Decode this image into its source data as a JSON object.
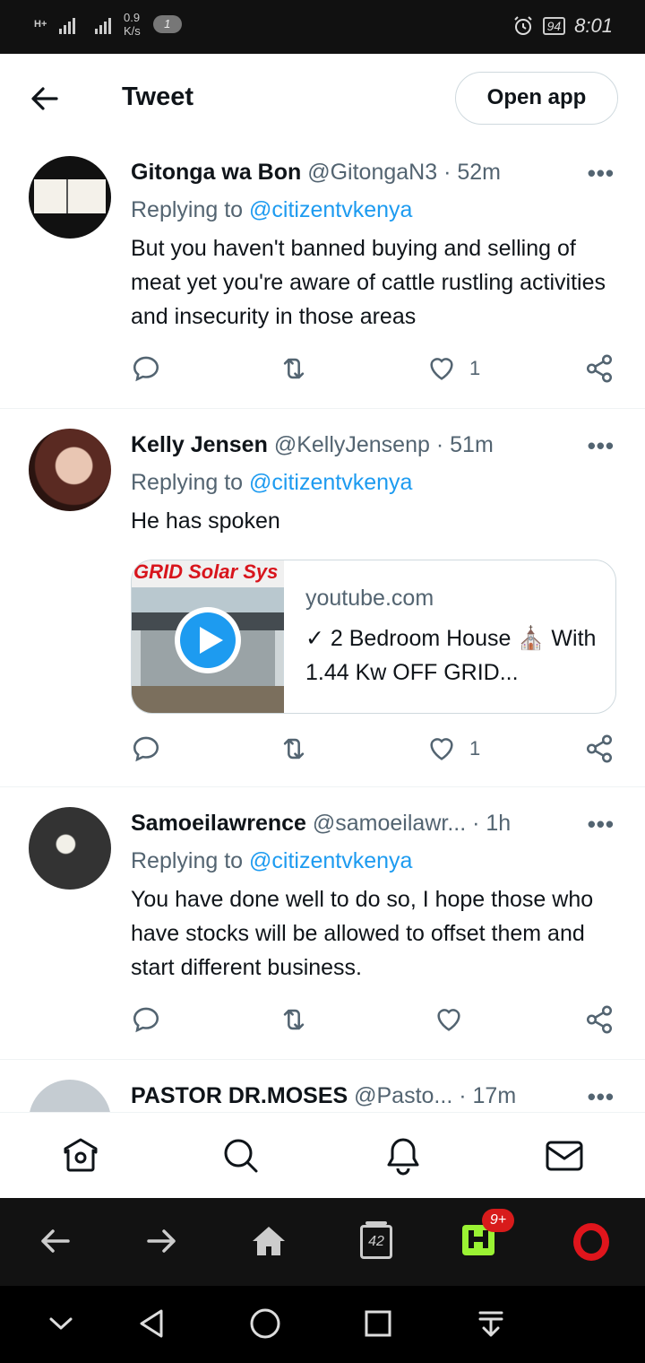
{
  "status_bar": {
    "network_label": "H+",
    "speed_value": "0.9",
    "speed_unit": "K/s",
    "notification_count": "1",
    "battery": "94",
    "time": "8:01"
  },
  "header": {
    "title": "Tweet",
    "open_app_label": "Open app"
  },
  "tweets": [
    {
      "name": "Gitonga wa Bon",
      "handle": "@GitongaN3",
      "time": "· 52m",
      "replying_prefix": "Replying to ",
      "replying_handle": "@citizentvkenya",
      "text": "But you haven't banned buying and selling of meat yet you're aware of  cattle rustling activities and insecurity in those areas",
      "likes": "1"
    },
    {
      "name": "Kelly Jensen",
      "handle": "@KellyJensenp",
      "time": "· 51m",
      "replying_prefix": "Replying to ",
      "replying_handle": "@citizentvkenya",
      "text": "He has spoken",
      "likes": "1",
      "card": {
        "thumb_text": "GRID  Solar Sys",
        "domain": "youtube.com",
        "title": "✓ 2 Bedroom House ⛪ With 1.44 Kw OFF GRID..."
      }
    },
    {
      "name": "Samoeilawrence",
      "handle": "@samoeilawr...",
      "time": " · 1h",
      "replying_prefix": "Replying to ",
      "replying_handle": "@citizentvkenya",
      "text": "You have done well to do so,  I hope those who have  stocks will be allowed to offset them and start different business.",
      "likes": ""
    },
    {
      "name": "PASTOR DR.MOSES",
      "handle": "@Pasto...",
      "time": " · 17m"
    }
  ],
  "browser_bar": {
    "tabs_count": "42",
    "hype_badge": "9+"
  },
  "colors": {
    "accent": "#1d9bf0",
    "secondary_text": "#536471",
    "opera_red": "#e0151c",
    "hype_green": "#9af233"
  }
}
